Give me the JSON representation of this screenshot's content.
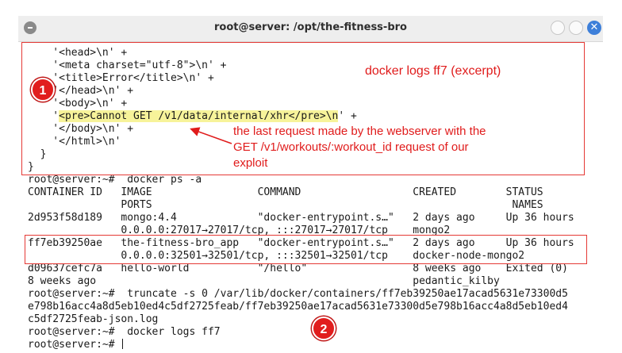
{
  "window": {
    "title": "root@server: /opt/the-fitness-bro",
    "left_icon": "terminal-menu-icon",
    "controls": [
      "minimize-icon",
      "maximize-icon",
      "close-icon"
    ],
    "close_glyph": "✕"
  },
  "terminal": {
    "lines": [
      "    '<head>\\n' +",
      "    '<meta charset=\"utf-8\">\\n' +",
      "    '<title>Error</title>\\n' +",
      "    '</head>\\n' +",
      "    '<body>\\n' +",
      "    '",
      "    '</body>\\n' +",
      "    '</html>\\n'",
      "  }",
      "}",
      "root@server:~#  docker ps -a",
      "CONTAINER ID   IMAGE                 COMMAND                  CREATED        STATUS",
      "               PORTS                                                          NAMES",
      "2d953f58d189   mongo:4.4             \"docker-entrypoint.s…\"   2 days ago     Up 36 hours",
      "               0.0.0.0:27017→27017/tcp, :::27017→27017/tcp    mongo2",
      "ff7eb39250ae   the-fitness-bro_app   \"docker-entrypoint.s…\"   2 days ago     Up 36 hours",
      "               0.0.0.0:32501→32501/tcp, :::32501→32501/tcp    docker-node-mongo2",
      "d09637cefc7a   hello-world           \"/hello\"                 8 weeks ago    Exited (0)",
      "8 weeks ago                                                   pedantic_kilby",
      "root@server:~#  truncate -s 0 /var/lib/docker/containers/ff7eb39250ae17acad5631e73300d5",
      "e798b16acc4a8d5eb10ed4c5df2725feab/ff7eb39250ae17acad5631e73300d5e798b16acc4a8d5eb10ed4",
      "c5df2725feab-json.log",
      "root@server:~#  docker logs ff7",
      "root@server:~# "
    ],
    "highlight_text": "<pre>Cannot GET /v1/data/internal/xhr</pre>\\n",
    "highlight_suffix": "' +",
    "cursor": "|"
  },
  "annotations": {
    "badge1": "1",
    "badge2": "2",
    "note_title": "docker logs ff7 (excerpt)",
    "note_body": [
      "the last request made by the webserver with the",
      "GET /v1/workouts/:workout_id request of our",
      "exploit"
    ],
    "color": "#e01b1b"
  }
}
